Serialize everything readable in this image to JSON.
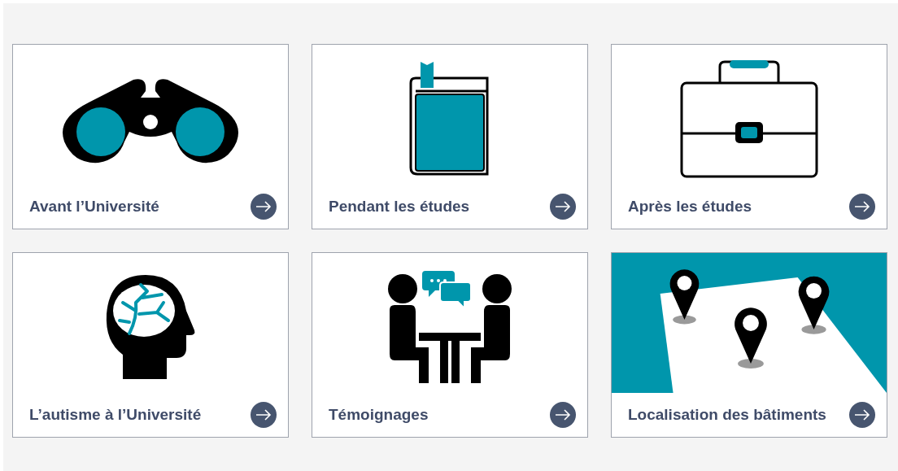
{
  "cards": [
    {
      "kind": "binoculars",
      "title": "Avant l’Université"
    },
    {
      "kind": "book",
      "title": "Pendant les études"
    },
    {
      "kind": "briefcase",
      "title": "Après les études"
    },
    {
      "kind": "head",
      "title": "L’autisme à l’Université"
    },
    {
      "kind": "meeting",
      "title": "Témoignages"
    },
    {
      "kind": "picture",
      "title": "Localisation des bâtiments"
    }
  ]
}
